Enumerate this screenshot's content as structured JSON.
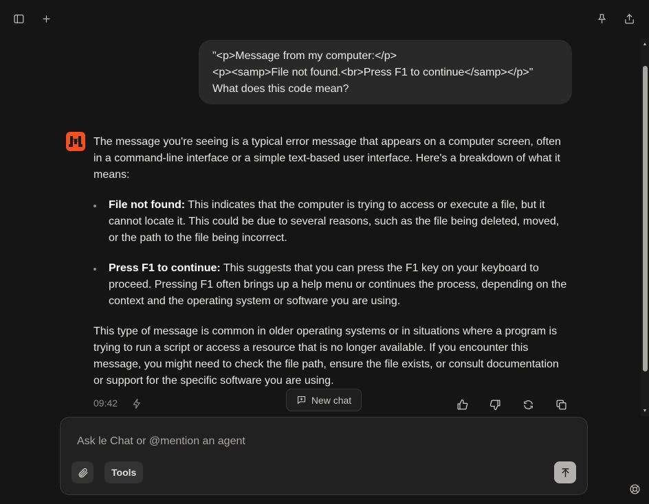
{
  "toolbar": {
    "left_icons": [
      "sidebar-toggle-icon",
      "plus-icon"
    ],
    "right_icons": [
      "pin-icon",
      "share-icon"
    ]
  },
  "user_message": {
    "lines": [
      "\"<p>Message from my computer:</p>",
      "<p><samp>File not found.<br>Press F1 to continue</samp></p>\"",
      "What does this code mean?"
    ]
  },
  "assistant": {
    "avatar_icon": "le-chat-cat-icon",
    "intro": "The message you're seeing is a typical error message that appears on a computer screen, often in a command-line interface or a simple text-based user interface. Here's a breakdown of what it means:",
    "bullets": [
      {
        "term": "File not found:",
        "text": " This indicates that the computer is trying to access or execute a file, but it cannot locate it. This could be due to several reasons, such as the file being deleted, moved, or the path to the file being incorrect."
      },
      {
        "term": "Press F1 to continue:",
        "text": " This suggests that you can press the F1 key on your keyboard to proceed. Pressing F1 often brings up a help menu or continues the process, depending on the context and the operating system or software you are using."
      }
    ],
    "conclusion": "This type of message is common in older operating systems or in situations where a program is trying to run a script or access a resource that is no longer available. If you encounter this message, you might need to check the file path, ensure the file exists, or consult documentation or support for the specific software you are using.",
    "timestamp": "09:42",
    "actions": [
      "thumbs-up-icon",
      "thumbs-down-icon",
      "regenerate-icon",
      "copy-icon"
    ]
  },
  "new_chat": {
    "label": "New chat"
  },
  "composer": {
    "placeholder": "Ask le Chat or @mention an agent",
    "tools_label": "Tools"
  },
  "colors": {
    "background": "#161516",
    "bubble": "#2a2929",
    "avatar": "#f4511e",
    "send_button": "#b3b1ae"
  }
}
